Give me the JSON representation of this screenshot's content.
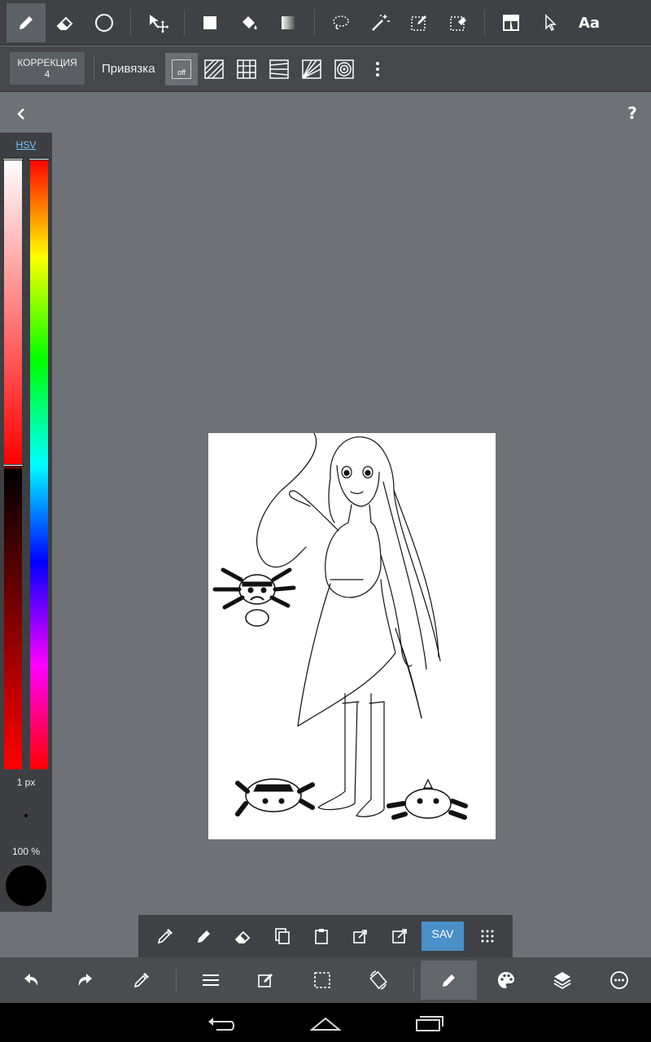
{
  "toolbar": {
    "tools": [
      {
        "name": "pen",
        "active": true
      },
      {
        "name": "eraser"
      },
      {
        "name": "brush-shape"
      },
      {
        "name": "move"
      },
      {
        "name": "fill-rect"
      },
      {
        "name": "bucket"
      },
      {
        "name": "gradient"
      },
      {
        "name": "lasso"
      },
      {
        "name": "magic-wand"
      },
      {
        "name": "select-pen"
      },
      {
        "name": "select-eraser"
      },
      {
        "name": "frame"
      },
      {
        "name": "operation"
      },
      {
        "name": "text"
      }
    ],
    "text_tool_label": "Aa"
  },
  "subbar": {
    "correction_label": "КОРРЕКЦИЯ",
    "correction_value": "4",
    "snap_label": "Привязка",
    "snap_off_label": "off"
  },
  "help_label": "?",
  "color_panel": {
    "mode_label": "HSV",
    "size_label": "1 px",
    "opacity_label": "100 %",
    "current_color": "#000000"
  },
  "float_toolbar": {
    "save_label": "SAV"
  },
  "bottom_bar": {
    "active_tool": "pen"
  }
}
